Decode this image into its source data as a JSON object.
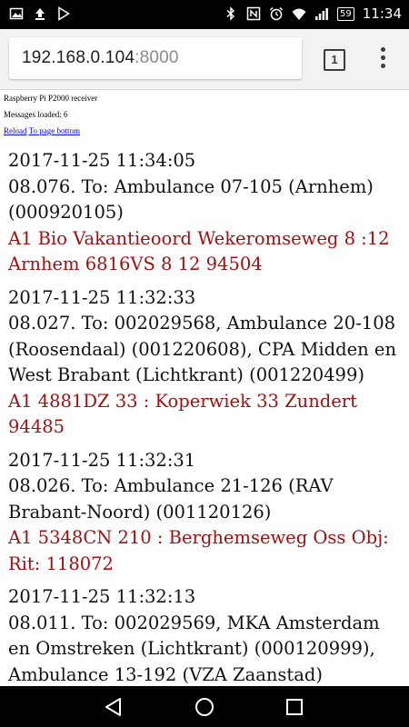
{
  "status_bar": {
    "time": "11:34",
    "battery": "59",
    "left_icons": [
      "image-notification-icon",
      "upload-icon",
      "play-store-icon"
    ],
    "right_icons": [
      "bluetooth-icon",
      "nfc-icon",
      "alarm-icon",
      "wifi-icon",
      "signal-icon",
      "battery-icon"
    ]
  },
  "browser": {
    "url_host": "192.168.0.104",
    "url_port": ":8000",
    "tab_count": "1"
  },
  "page": {
    "heading": "Raspberry Pi P2000 receiver",
    "loaded": "Messages loaded: 6",
    "reload_link": "Reload",
    "bottom_link": "To page bottom",
    "messages": [
      {
        "timestamp": "2017-11-25 11:34:05",
        "recipients": "08.076. To: Ambulance 07-105 (Arnhem) (000920105)",
        "body": "A1 Bio Vakantieoord Wekeromseweg 8 :12 Arnhem 6816VS 8 12 94504"
      },
      {
        "timestamp": "2017-11-25 11:32:33",
        "recipients": "08.027. To: 002029568, Ambulance 20-108 (Roosendaal) (001220608), CPA Midden en West Brabant (Lichtkrant) (001220499)",
        "body": "A1 4881DZ 33 : Koperwiek 33 Zundert 94485"
      },
      {
        "timestamp": "2017-11-25 11:32:31",
        "recipients": "08.026. To: Ambulance 21-126 (RAV Brabant-Noord) (001120126)",
        "body": "A1 5348CN 210 : Berghemseweg Oss Obj: Rit: 118072"
      },
      {
        "timestamp": "2017-11-25 11:32:13",
        "recipients": "08.011. To: 002029569, MKA Amsterdam en Omstreken (Lichtkrant) (000120999), Ambulance 13-192 (VZA Zaanstad)",
        "body": ""
      }
    ]
  },
  "nav": {
    "buttons": [
      "back-button",
      "home-button",
      "recents-button"
    ]
  }
}
